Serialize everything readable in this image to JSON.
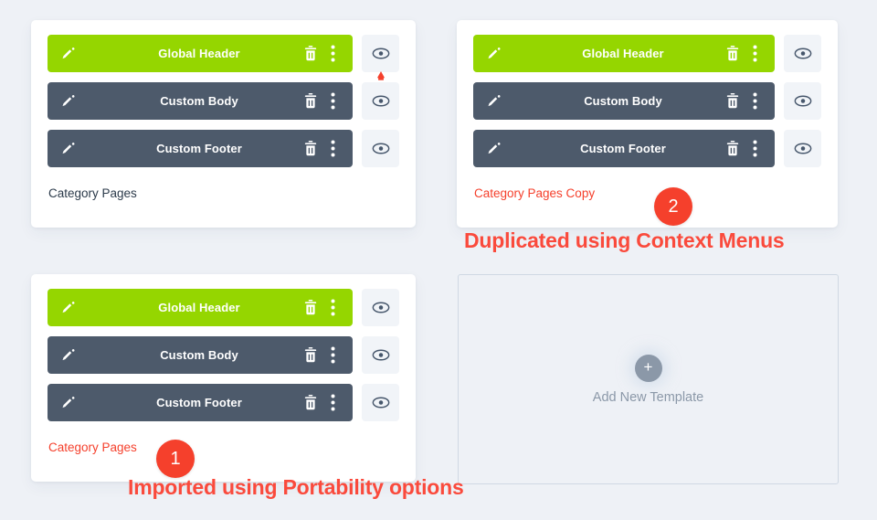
{
  "page": {
    "background_color": "#eef1f6"
  },
  "colors": {
    "green_bar": "#95d600",
    "slate_bar": "#4d5a6b",
    "annotation_red": "#f5402c",
    "muted_text": "#8b98a8",
    "card_label": "#2b3a4a"
  },
  "cards": [
    {
      "id": "category-pages-imported-top",
      "label": "Category Pages",
      "label_color": "#2b3a4a",
      "rows": [
        {
          "title": "Global Header",
          "style": "green",
          "pointer": false
        },
        {
          "title": "Custom Body",
          "style": "slate",
          "pointer": true
        },
        {
          "title": "Custom Footer",
          "style": "slate",
          "pointer": false
        }
      ]
    },
    {
      "id": "category-pages-copy",
      "label": "Category Pages Copy",
      "label_color": "#f5402c",
      "rows": [
        {
          "title": "Global Header",
          "style": "green",
          "pointer": false
        },
        {
          "title": "Custom Body",
          "style": "slate",
          "pointer": false
        },
        {
          "title": "Custom Footer",
          "style": "slate",
          "pointer": false
        }
      ]
    },
    {
      "id": "category-pages-imported",
      "label": "Category Pages",
      "label_color": "#f5402c",
      "rows": [
        {
          "title": "Global Header",
          "style": "green",
          "pointer": false
        },
        {
          "title": "Custom Body",
          "style": "slate",
          "pointer": false
        },
        {
          "title": "Custom Footer",
          "style": "slate",
          "pointer": false
        }
      ]
    }
  ],
  "row_icons": {
    "edit": "pencil-icon",
    "delete": "trash-icon",
    "more": "more-vertical-icon",
    "visibility": "eye-icon"
  },
  "add_template": {
    "label": "Add New Template",
    "icon": "plus-icon"
  },
  "annotations": [
    {
      "number": "1",
      "caption": "Imported using Portability options"
    },
    {
      "number": "2",
      "caption": "Duplicated using Context Menus"
    }
  ]
}
